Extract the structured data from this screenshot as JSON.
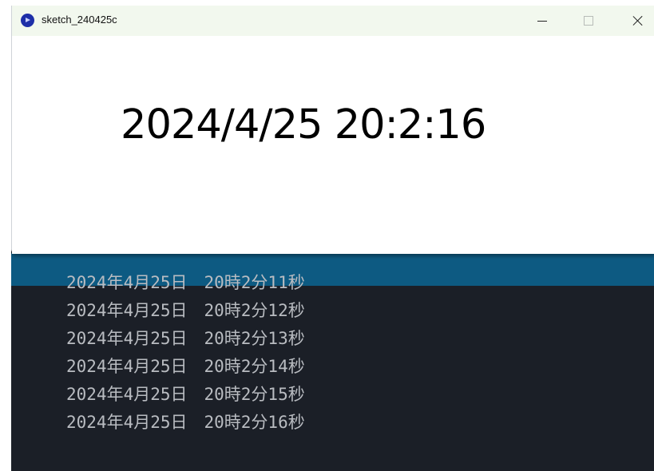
{
  "window": {
    "title": "sketch_240425c",
    "icon": "processing-app-icon",
    "controls": {
      "minimize": "minimize-icon",
      "maximize": "maximize-icon",
      "close": "close-icon"
    }
  },
  "canvas": {
    "datetime": "2024/4/25 20:2:16"
  },
  "console": {
    "lines": [
      "2024年4月25日　20時2分11秒",
      "2024年4月25日　20時2分12秒",
      "2024年4月25日　20時2分13秒",
      "2024年4月25日　20時2分14秒",
      "2024年4月25日　20時2分15秒",
      "2024年4月25日　20時2分16秒"
    ]
  },
  "colors": {
    "titlebar_bg": "#f2f8ee",
    "console_bg": "#1b1f27",
    "console_band": "#0d5a82",
    "console_text": "#b9bcc1",
    "app_icon": "#1e2fa8"
  }
}
